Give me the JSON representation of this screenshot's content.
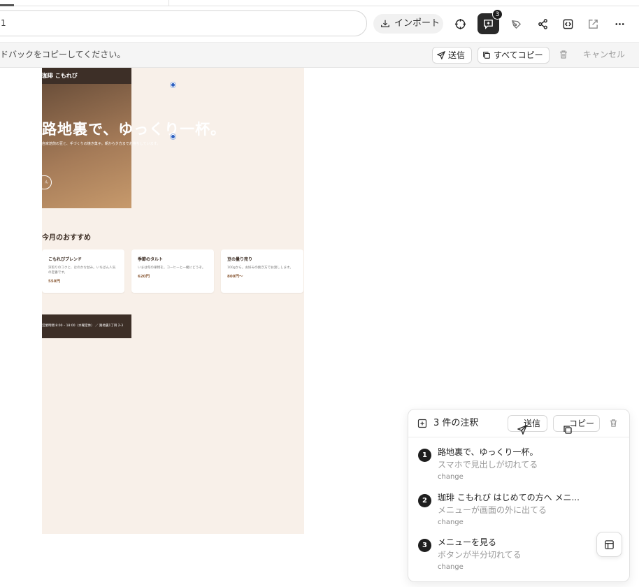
{
  "browser": {
    "url_text": "1",
    "import_label": "インポート",
    "annotation_badge": "3"
  },
  "infobar": {
    "message": "ドバックをコピーしてください。",
    "send_label": "送信",
    "copy_all_label": "すべてコピー",
    "cancel_label": "キャンセル"
  },
  "site": {
    "brand": "珈琲 こもれび",
    "hero_title": "路地裏で、ゆっくり一杯。",
    "hero_sub": "自家焙煎の豆と、手づくりの焼き菓子。朝から夕方までお待ちしています。",
    "hero_button": "ん",
    "section_title": "今月のおすすめ",
    "cards": [
      {
        "name": "こもれびブレンド",
        "desc": "深煎りのコクと、ほのかな甘み。いちばん人気の定番です。",
        "price": "550円"
      },
      {
        "name": "季節のタルト",
        "desc": "いまは旬の果物を。コーヒーと一緒にどうぞ。",
        "price": "620円"
      },
      {
        "name": "豆の量り売り",
        "desc": "100gから。お好みの挽き方でお渡しします。",
        "price": "800円〜"
      }
    ],
    "footer": "営業時間 8:00 – 18:00（水曜定休） ／ 路地裏1丁目 2-3"
  },
  "panel": {
    "title": "3 件の注釈",
    "send_label": "送信",
    "copy_label": "コピー",
    "annotations": [
      {
        "num": "1",
        "target": "路地裏で、ゆっくり一杯。",
        "comment": "スマホで見出しが切れてる",
        "kind": "change"
      },
      {
        "num": "2",
        "target": "珈琲 こもれび はじめての方へ メニ...",
        "comment": "メニューが画面の外に出てる",
        "kind": "change"
      },
      {
        "num": "3",
        "target": "メニューを見る",
        "comment": "ボタンが半分切れてる",
        "kind": "change"
      }
    ]
  }
}
